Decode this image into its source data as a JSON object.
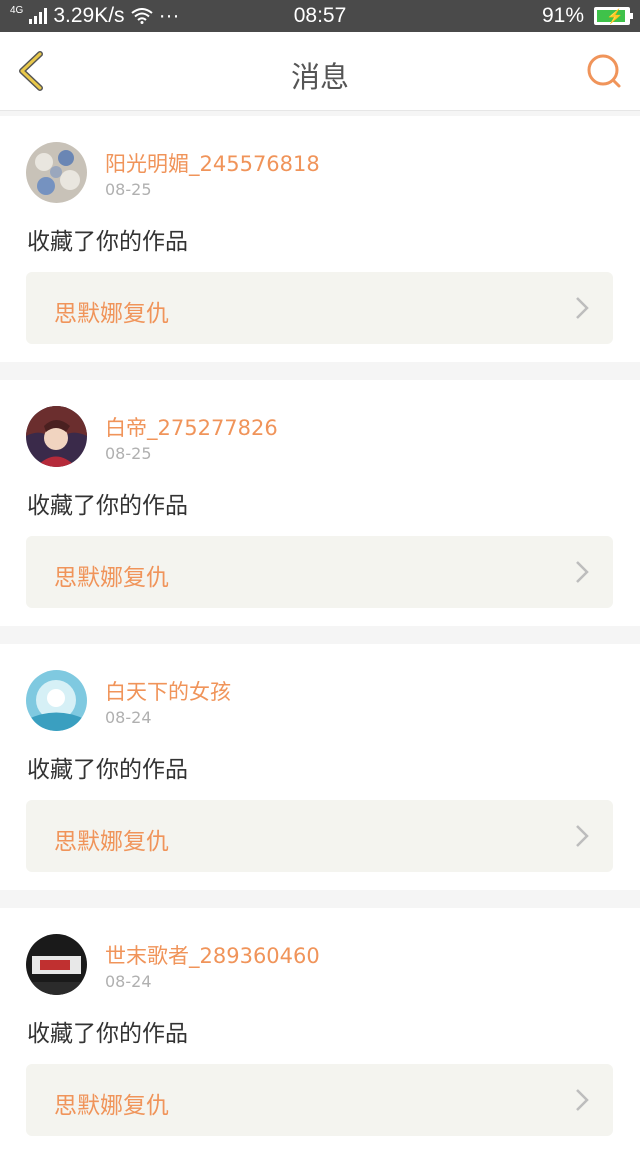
{
  "status_bar": {
    "network": "4G",
    "speed": "3.29K/s",
    "dots": "···",
    "time": "08:57",
    "battery": "91%",
    "battery_level": 0.91
  },
  "header": {
    "title": "消息"
  },
  "colors": {
    "accent": "#f0945a",
    "back_icon": "#e8c84a",
    "card_bg": "#f4f4ef"
  },
  "messages": [
    {
      "username": "阳光明媚_245576818",
      "date": "08-25",
      "action": "收藏了你的作品",
      "work_title": "思默娜复仇",
      "avatar_icon": "avatar-pattern-icon"
    },
    {
      "username": "白帝_275277826",
      "date": "08-25",
      "action": "收藏了你的作品",
      "work_title": "思默娜复仇",
      "avatar_icon": "avatar-anime-icon"
    },
    {
      "username": "白天下的女孩",
      "date": "08-24",
      "action": "收藏了你的作品",
      "work_title": "思默娜复仇",
      "avatar_icon": "avatar-blue-icon"
    },
    {
      "username": "世末歌者_289360460",
      "date": "08-24",
      "action": "收藏了你的作品",
      "work_title": "思默娜复仇",
      "avatar_icon": "avatar-dark-icon"
    }
  ]
}
